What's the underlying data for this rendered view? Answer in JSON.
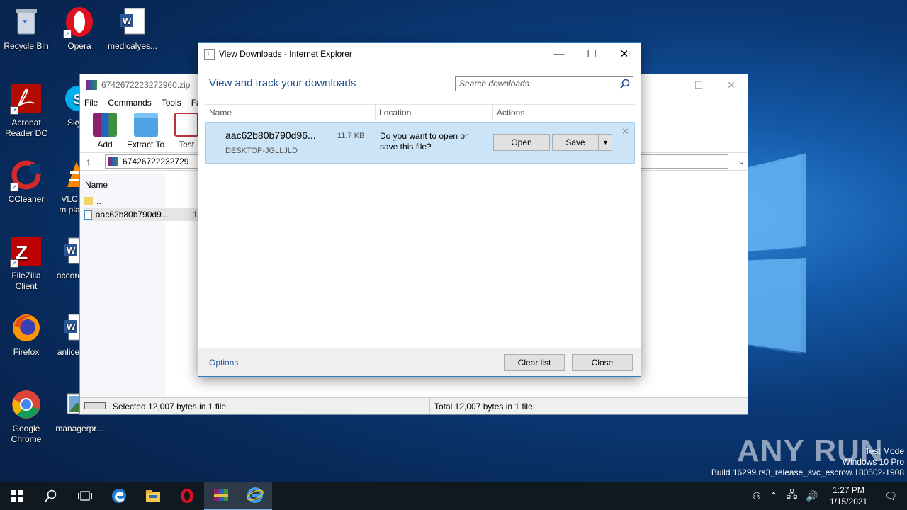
{
  "desktop": {
    "icons": [
      {
        "label": "Recycle Bin"
      },
      {
        "label": "Opera"
      },
      {
        "label": "medicalyes..."
      },
      {
        "label": "Acrobat Reader DC"
      },
      {
        "label": "Sky"
      },
      {
        "label": "CCleaner"
      },
      {
        "label": "VLC m pla"
      },
      {
        "label": "FileZilla Client"
      },
      {
        "label": "accord"
      },
      {
        "label": "Firefox"
      },
      {
        "label": "anlice"
      },
      {
        "label": "Google Chrome"
      },
      {
        "label": "managerpr..."
      }
    ]
  },
  "rar": {
    "title": "6742672223272960.zip",
    "menu": [
      "File",
      "Commands",
      "Tools",
      "Fa"
    ],
    "tools": [
      "Add",
      "Extract To",
      "Test"
    ],
    "address": "67426722232729",
    "column_name": "Name",
    "rows": [
      {
        "name": ".."
      },
      {
        "name": "aac62b80b790d9..."
      }
    ],
    "row_extra": "1",
    "status_left": "Selected 12,007 bytes in 1 file",
    "status_right": "Total 12,007 bytes in 1 file"
  },
  "ie": {
    "title": "View Downloads - Internet Explorer",
    "heading": "View and track your downloads",
    "search_placeholder": "Search downloads",
    "columns": {
      "name": "Name",
      "location": "Location",
      "actions": "Actions"
    },
    "item": {
      "filename": "aac62b80b790d96...",
      "size": "11.7 KB",
      "host": "DESKTOP-JGLLJLD",
      "question": "Do you want to open or save this file?"
    },
    "buttons": {
      "open": "Open",
      "save": "Save",
      "clear": "Clear list",
      "close": "Close"
    },
    "options_link": "Options"
  },
  "watermark": {
    "brand": "ANY RUN",
    "mode": "Test Mode",
    "os": "Windows 10 Pro",
    "build": "Build 16299.rs3_release_svc_escrow.180502-1908"
  },
  "taskbar": {
    "time": "1:27 PM",
    "date": "1/15/2021"
  }
}
